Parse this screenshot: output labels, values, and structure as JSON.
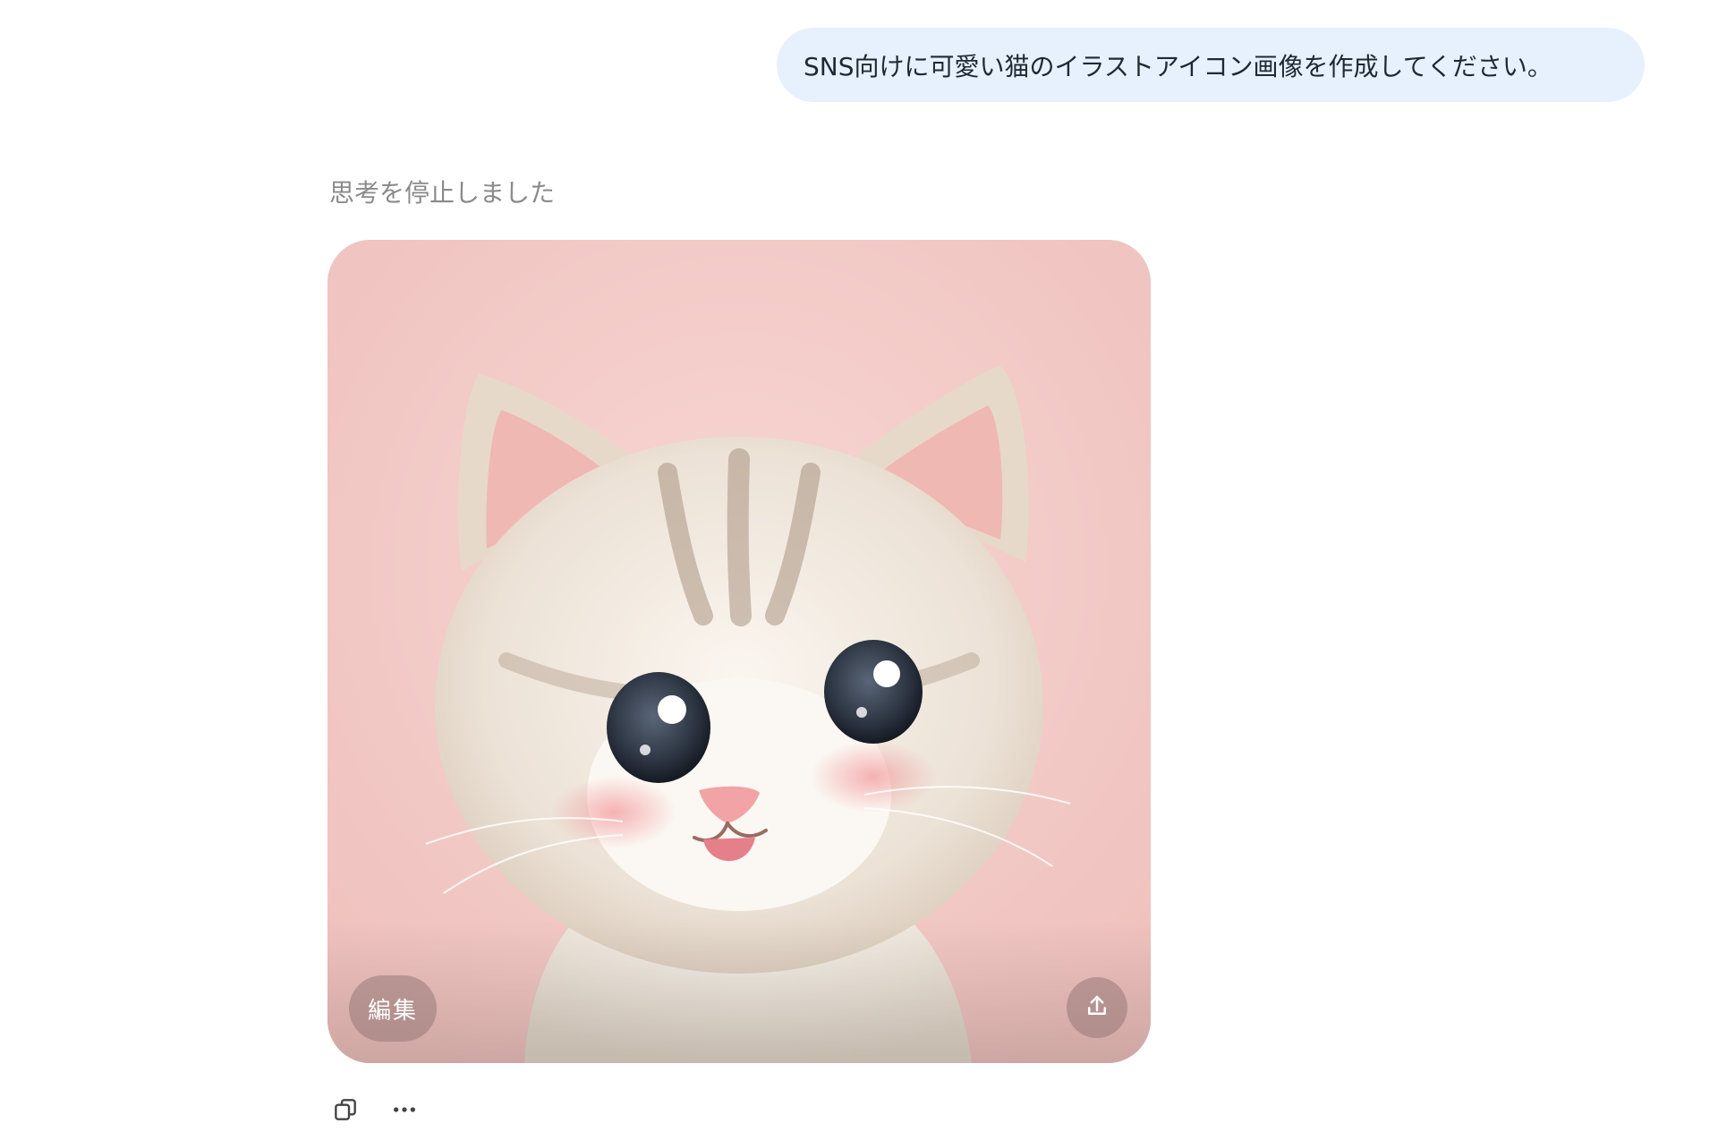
{
  "chat": {
    "user_message": "SNS向けに可愛い猫のイラストアイコン画像を作成してください。",
    "status_text": "思考を停止しました"
  },
  "generated_image": {
    "edit_label": "編集",
    "background_color": "#f3c9c6",
    "share_icon": "upload-icon"
  },
  "actions": {
    "copy_icon": "copy-icon",
    "more_icon": "more-horizontal-icon"
  }
}
